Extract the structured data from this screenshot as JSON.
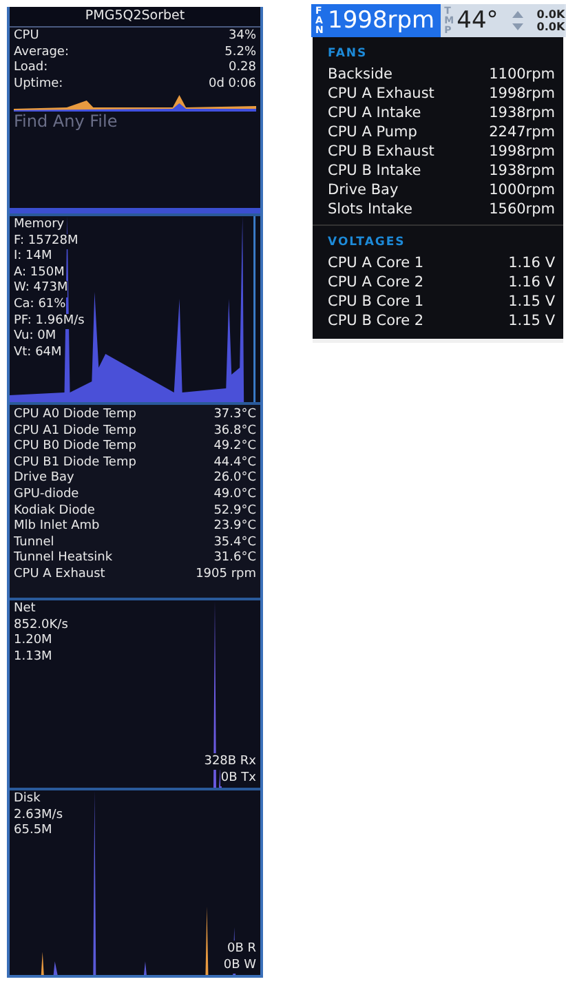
{
  "monitor": {
    "title": "PMG5Q2Sorbet",
    "cpu": {
      "rows": [
        {
          "label": "CPU",
          "value": "34%"
        },
        {
          "label": "Average:",
          "value": "5.2%"
        },
        {
          "label": "Load:",
          "value": "0.28"
        },
        {
          "label": "Uptime:",
          "value": "0d 0:06"
        }
      ],
      "behind_text": "Find Any File"
    },
    "memory": {
      "lines": [
        "Memory",
        "F: 15728M",
        "I: 14M",
        "A: 150M",
        "W: 473M",
        "Ca: 61%",
        "PF: 1.96M/s",
        "Vu: 0M",
        "Vt: 64M"
      ]
    },
    "sensors": [
      {
        "label": "CPU A0 Diode Temp",
        "value": "37.3°C"
      },
      {
        "label": "CPU A1 Diode Temp",
        "value": "36.8°C"
      },
      {
        "label": "CPU B0 Diode Temp",
        "value": "49.2°C"
      },
      {
        "label": "CPU B1 Diode Temp",
        "value": "44.4°C"
      },
      {
        "label": "Drive Bay",
        "value": "26.0°C"
      },
      {
        "label": "GPU-diode",
        "value": "49.0°C"
      },
      {
        "label": "Kodiak Diode",
        "value": "52.9°C"
      },
      {
        "label": "Mlb Inlet Amb",
        "value": "23.9°C"
      },
      {
        "label": "Tunnel",
        "value": "35.4°C"
      },
      {
        "label": "Tunnel Heatsink",
        "value": "31.6°C"
      },
      {
        "label": "CPU A Exhaust",
        "value": "1905 rpm"
      }
    ],
    "net": {
      "lines": [
        "Net",
        "852.0K/s",
        "1.20M",
        "1.13M"
      ],
      "corner": [
        "328B Rx",
        "0B Tx"
      ]
    },
    "disk": {
      "lines": [
        "Disk",
        "2.63M/s",
        "65.5M"
      ],
      "corner": [
        "0B R",
        "0B W"
      ]
    }
  },
  "menubar": {
    "fan_tag": "FAN",
    "fan_value": "1998rpm",
    "temp_tag": "TMP",
    "temp_value": "44°",
    "net_up": "0.0K",
    "net_down": "0.0K"
  },
  "menu": {
    "sections": [
      {
        "heading": "FANS",
        "rows": [
          {
            "label": "Backside",
            "value": "1100rpm"
          },
          {
            "label": "CPU A Exhaust",
            "value": "1998rpm"
          },
          {
            "label": "CPU A Intake",
            "value": "1938rpm"
          },
          {
            "label": "CPU A Pump",
            "value": "2247rpm"
          },
          {
            "label": "CPU B Exhaust",
            "value": "1998rpm"
          },
          {
            "label": "CPU B Intake",
            "value": "1938rpm"
          },
          {
            "label": "Drive Bay",
            "value": "1000rpm"
          },
          {
            "label": "Slots Intake",
            "value": "1560rpm"
          }
        ]
      },
      {
        "heading": "VOLTAGES",
        "rows": [
          {
            "label": "CPU A Core 1",
            "value": "1.16 V"
          },
          {
            "label": "CPU A Core 2",
            "value": "1.16 V"
          },
          {
            "label": "CPU B Core 1",
            "value": "1.15 V"
          },
          {
            "label": "CPU B Core 2",
            "value": "1.15 V"
          }
        ]
      }
    ]
  }
}
